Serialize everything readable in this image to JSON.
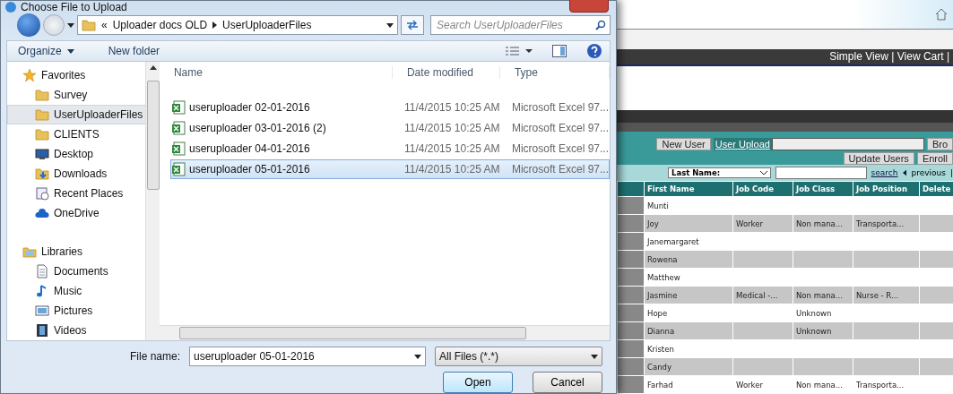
{
  "dialog": {
    "title": "Choose File to Upload",
    "address": {
      "parent": "Uploader docs OLD",
      "current": "UserUploaderFiles",
      "overflow": "«"
    },
    "search": {
      "placeholder": "Search UserUploaderFiles"
    },
    "toolbar": {
      "organize": "Organize",
      "new_folder": "New folder"
    },
    "nav_items": [
      {
        "label": "Favorites",
        "kind": "favorites",
        "selected": false
      },
      {
        "label": "Survey",
        "kind": "folder",
        "selected": false
      },
      {
        "label": "UserUploaderFiles",
        "kind": "folder",
        "selected": true
      },
      {
        "label": "CLIENTS",
        "kind": "folder",
        "selected": false
      },
      {
        "label": "Desktop",
        "kind": "desktop",
        "selected": false
      },
      {
        "label": "Downloads",
        "kind": "downloads",
        "selected": false
      },
      {
        "label": "Recent Places",
        "kind": "recent",
        "selected": false
      },
      {
        "label": "OneDrive",
        "kind": "cloud",
        "selected": false
      },
      {
        "label": "Libraries",
        "kind": "libraries",
        "selected": false
      },
      {
        "label": "Documents",
        "kind": "documents",
        "selected": false
      },
      {
        "label": "Music",
        "kind": "music",
        "selected": false
      },
      {
        "label": "Pictures",
        "kind": "pictures",
        "selected": false
      },
      {
        "label": "Videos",
        "kind": "videos",
        "selected": false
      }
    ],
    "columns": [
      "Name",
      "Date modified",
      "Type"
    ],
    "files": [
      {
        "name": "useruploader 02-01-2016",
        "date": "11/4/2015 10:25 AM",
        "type": "Microsoft Excel 97...",
        "selected": false
      },
      {
        "name": "useruploader 03-01-2016 (2)",
        "date": "11/4/2015 10:25 AM",
        "type": "Microsoft Excel 97...",
        "selected": false
      },
      {
        "name": "useruploader 04-01-2016",
        "date": "11/4/2015 10:25 AM",
        "type": "Microsoft Excel 97...",
        "selected": false
      },
      {
        "name": "useruploader 05-01-2016",
        "date": "11/4/2015 10:25 AM",
        "type": "Microsoft Excel 97...",
        "selected": true
      }
    ],
    "file_name": {
      "label": "File name:",
      "value": "useruploader 05-01-2016"
    },
    "filter": "All Files (*.*)",
    "buttons": [
      "Open",
      "Cancel"
    ]
  },
  "page": {
    "nav_links": "Simple View | View Cart |",
    "new_user": "New User",
    "upload_label": "User Upload",
    "browse": "Bro",
    "update_users": "Update Users",
    "enroll": "Enroll",
    "search_by": "Last Name:",
    "search_link": "search",
    "previous": "previous",
    "separator": "|",
    "table": {
      "columns": [
        "First Name",
        "Job Code",
        "Job Class",
        "Job Position",
        "Delete"
      ],
      "rows": [
        {
          "first_name": "Munti"
        },
        {
          "first_name": "Joy",
          "job_code": "Worker",
          "job_class": "Non mana...",
          "job_position": "Transporta..."
        },
        {
          "first_name": "Janemargaret"
        },
        {
          "first_name": "Rowena"
        },
        {
          "first_name": "Matthew"
        },
        {
          "first_name": "Jasmine",
          "job_code": "Medical -...",
          "job_class": "Non mana...",
          "job_position": "Nurse - R..."
        },
        {
          "first_name": "Hope",
          "job_class": "Unknown"
        },
        {
          "first_name": "Dianna",
          "job_class": "Unknown"
        },
        {
          "first_name": "Kristen"
        },
        {
          "first_name": "Candy"
        },
        {
          "first_name": "Farhad",
          "job_code": "Worker",
          "job_class": "Non mana...",
          "job_position": "Transporta..."
        }
      ]
    }
  }
}
